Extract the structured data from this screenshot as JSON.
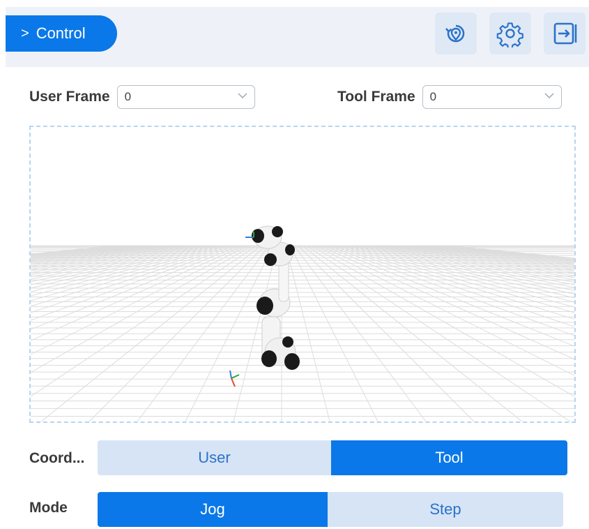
{
  "header": {
    "title": "Control",
    "title_icon": "chevron-right-icon",
    "actions": [
      {
        "name": "relocate-view-button",
        "icon": "location-refresh-icon"
      },
      {
        "name": "settings-button",
        "icon": "gear-icon"
      },
      {
        "name": "exit-button",
        "icon": "exit-icon"
      }
    ]
  },
  "frames": {
    "user_frame_label": "User Frame",
    "user_frame_value": "0",
    "tool_frame_label": "Tool Frame",
    "tool_frame_value": "0"
  },
  "coord": {
    "label": "Coord...",
    "options": [
      "User",
      "Tool"
    ],
    "selected": "Tool"
  },
  "mode": {
    "label": "Mode",
    "options": [
      "Jog",
      "Step"
    ],
    "selected": "Jog"
  },
  "colors": {
    "accent": "#0a78e8",
    "inactive": "#d6e4f5",
    "header_bg": "#eef2f8"
  }
}
